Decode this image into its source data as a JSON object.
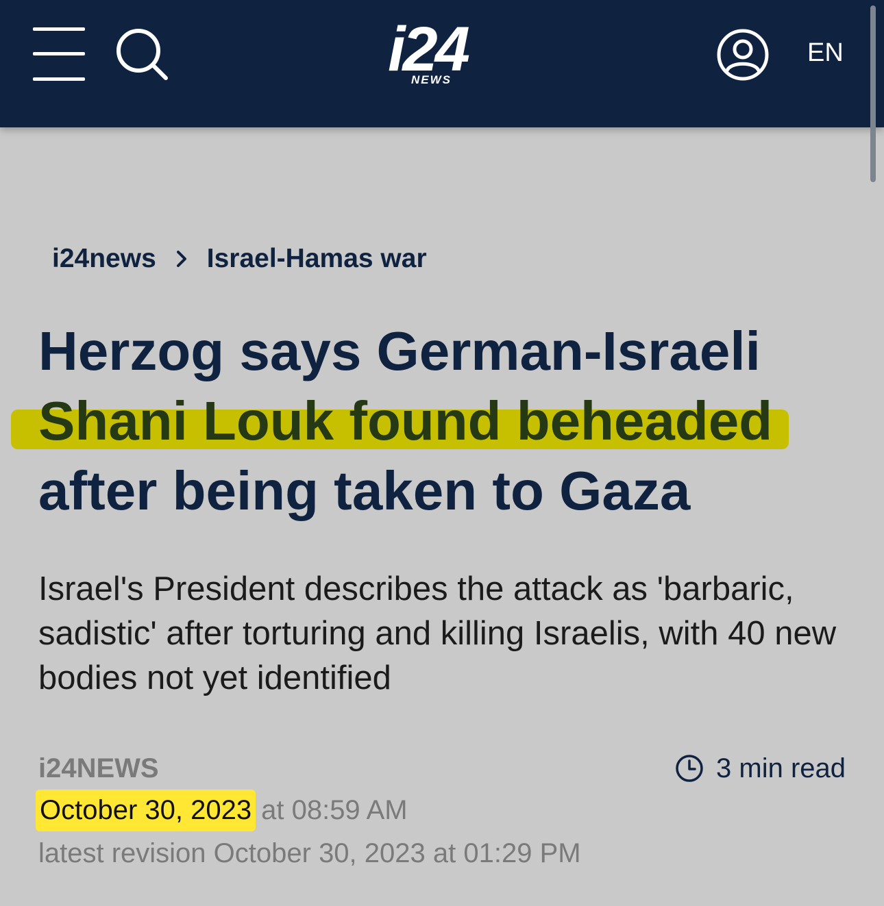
{
  "header": {
    "logo_main": "i24",
    "logo_sub": "NEWS",
    "language": "EN"
  },
  "breadcrumb": {
    "home": "i24news",
    "section": "Israel-Hamas war"
  },
  "article": {
    "headline_lines": [
      "Herzog says German-Israeli",
      "Shani Louk found beheaded",
      "after being taken to Gaza"
    ],
    "summary": "Israel's President describes the attack as 'barbaric, sadistic' after torturing and killing Israelis, with 40 new bodies not yet identified",
    "source": "i24NEWS",
    "read_time": "3 min read",
    "date": "October 30, 2023",
    "time": "at 08:59 AM",
    "revision": "latest revision October 30, 2023 at 01:29 PM"
  },
  "colors": {
    "header_bg": "#0f2240",
    "page_bg": "#c9c9c9",
    "headline_highlight": "#c7c000",
    "date_highlight": "#ffe733"
  },
  "icons": [
    "menu-icon",
    "search-icon",
    "account-icon",
    "chevron-right-icon",
    "clock-icon"
  ]
}
